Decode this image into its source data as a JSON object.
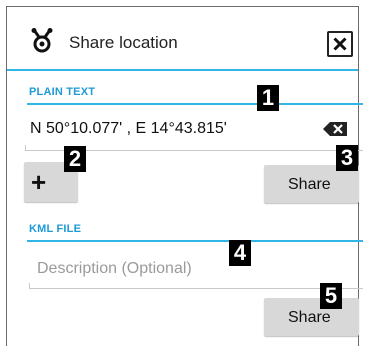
{
  "dialog": {
    "title": "Share location",
    "title_icon": "cgeo-logo-icon",
    "close_icon": "close-box-icon"
  },
  "plain_text": {
    "header": "PLAIN TEXT",
    "coordinates": "N 50°10.077' , E 14°43.815'",
    "clear_icon": "backspace-clear-icon",
    "add_label": "+",
    "share_label": "Share"
  },
  "kml_file": {
    "header": "KML FILE",
    "description_placeholder": "Description (Optional)",
    "share_label": "Share"
  },
  "annotations": [
    "1",
    "2",
    "3",
    "4",
    "5"
  ],
  "colors": {
    "accent": "#33b5e5",
    "header_text": "#1e9ad6",
    "button_bg": "#d8d8d8"
  }
}
